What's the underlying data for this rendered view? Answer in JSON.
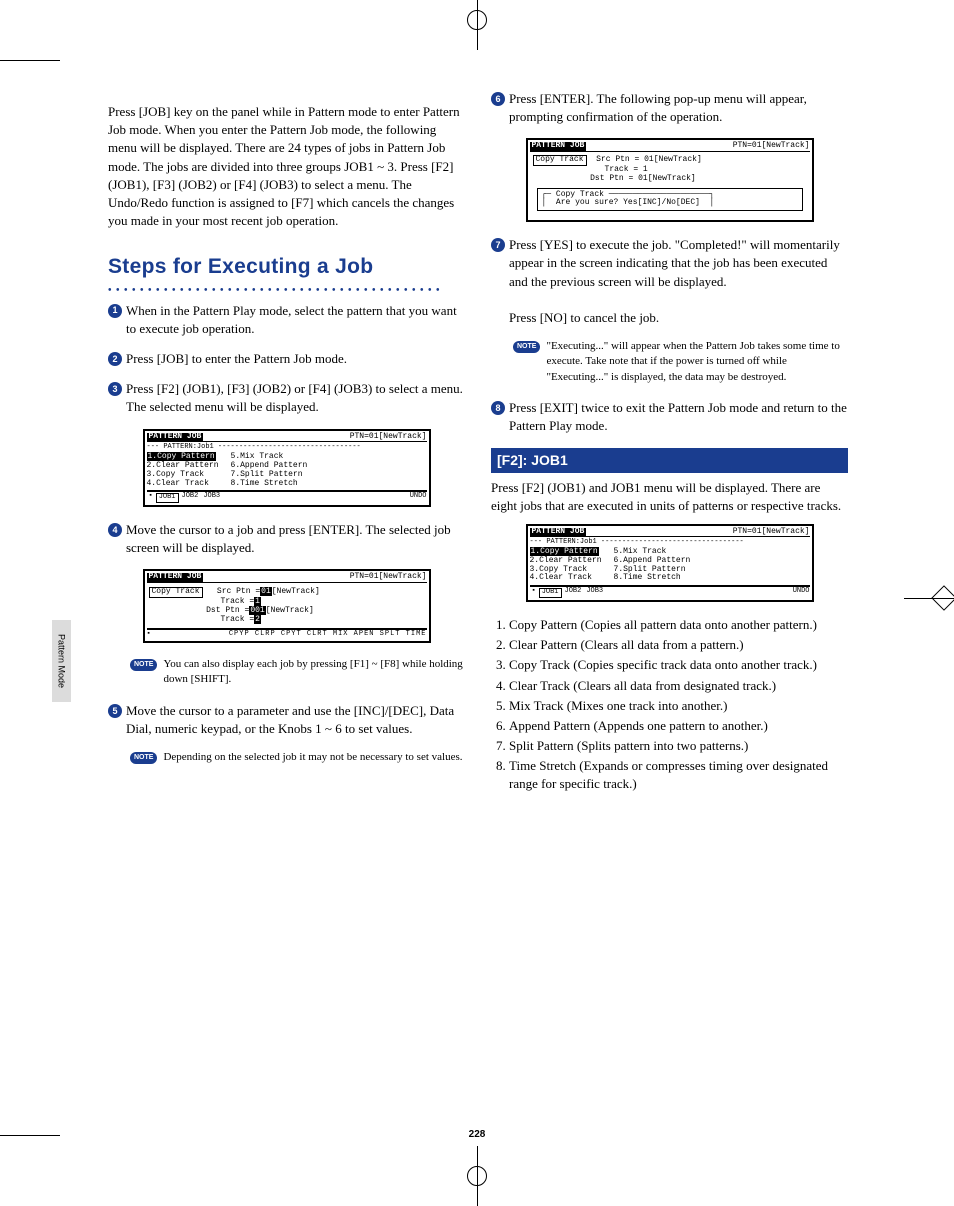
{
  "page_number": "228",
  "side_tab": "Pattern Mode",
  "intro": "Press [JOB] key on the panel while in Pattern mode to enter Pattern Job mode. When you enter the Pattern Job mode, the following menu will be displayed. There are 24 types of jobs in Pattern Job mode. The jobs are divided into three groups JOB1 ~ 3. Press [F2] (JOB1), [F3] (JOB2) or [F4] (JOB3) to select a menu. The Undo/Redo function is assigned to [F7] which cancels the changes you made in your most recent job operation.",
  "heading": "Steps for Executing a Job",
  "steps": {
    "s1": "When in the Pattern Play mode, select the pattern that you want to execute job operation.",
    "s2": "Press [JOB] to enter the Pattern Job mode.",
    "s3": "Press [F2] (JOB1), [F3] (JOB2) or [F4] (JOB3) to select a menu. The selected menu will be displayed.",
    "s4": "Move the cursor to a job and press [ENTER]. The selected job screen will be displayed.",
    "s5": "Move the cursor to a parameter and use the [INC]/[DEC], Data Dial, numeric keypad, or the Knobs 1 ~ 6 to set values.",
    "s6": "Press [ENTER]. The following pop-up menu will appear, prompting confirmation of the operation.",
    "s7a": "Press [YES] to execute the job. \"Completed!\" will momentarily appear in the screen indicating that the job has been executed and the previous screen will be displayed.",
    "s7b": "Press [NO] to cancel the job.",
    "s8": "Press [EXIT] twice to exit the Pattern Job mode and return to the Pattern Play mode."
  },
  "notes": {
    "n1": "You can also display each job by pressing [F1] ~ [F8] while holding down [SHIFT].",
    "n2": "Depending on the selected job it may not be necessary to set values.",
    "n3": "\"Executing...\" will appear when the Pattern Job takes some time to execute. Take note that if the power is turned off while \"Executing...\" is displayed, the data may be destroyed.",
    "label": "NOTE"
  },
  "lcd": {
    "title": "PATTERN JOB",
    "ptn": "PTN=01[NewTrack]",
    "sub1": "PATTERN:Job1",
    "menu_left": [
      "1.Copy   Pattern",
      "2.Clear  Pattern",
      "3.Copy   Track",
      "4.Clear  Track"
    ],
    "menu_right": [
      "5.Mix    Track",
      "6.Append Pattern",
      "7.Split  Pattern",
      "8.Time   Stretch"
    ],
    "tabs1": [
      "JOB1",
      "JOB2",
      "JOB3"
    ],
    "undo": "UNDO",
    "copy_track": "Copy Track",
    "srcptn": "Src Ptn =",
    "val01": "01",
    "nt": "[NewTrack]",
    "trackeq": "Track =",
    "v1": "1",
    "dstptn": "Dst Ptn =",
    "v001": "001",
    "v2": "2",
    "ftr2": "CPYP CLRP CPYT CLRT MIX APEN SPLT TIME",
    "confirm_title": "Copy Track",
    "confirm": "Are you sure?  Yes[INC]/No[DEC]",
    "src_line": "Src Ptn = 01[NewTrack]",
    "trk_line": "Track = 1",
    "dst_line": "Dst Ptn = 01[NewTrack]"
  },
  "f2": {
    "bar": "[F2]: JOB1",
    "intro": "Press [F2] (JOB1) and JOB1 menu will be displayed. There are eight jobs that are executed in units of patterns or respective tracks.",
    "jobs": [
      "Copy Pattern (Copies all pattern data onto another pattern.)",
      "Clear Pattern (Clears all data from a pattern.)",
      "Copy Track (Copies specific track data onto another track.)",
      "Clear Track (Clears all data from designated track.)",
      "Mix Track (Mixes one track into another.)",
      "Append Pattern (Appends one pattern to another.)",
      "Split Pattern (Splits pattern into two patterns.)",
      "Time Stretch (Expands or compresses timing over designated range for specific track.)"
    ]
  }
}
